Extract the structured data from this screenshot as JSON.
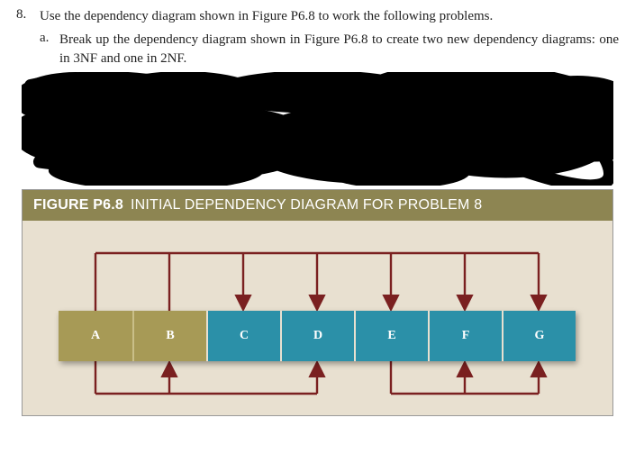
{
  "question": {
    "number": "8.",
    "text": "Use the dependency diagram shown in Figure P6.8 to work the following problems."
  },
  "sub": {
    "letter": "a.",
    "text": "Break up the dependency diagram shown in Figure P6.8 to create two new dependency diagrams: one in 3NF and one in 2NF."
  },
  "figure": {
    "label": "FIGURE P6.8",
    "title": "INITIAL DEPENDENCY DIAGRAM FOR PROBLEM 8",
    "cells": [
      "A",
      "B",
      "C",
      "D",
      "E",
      "F",
      "G"
    ]
  }
}
